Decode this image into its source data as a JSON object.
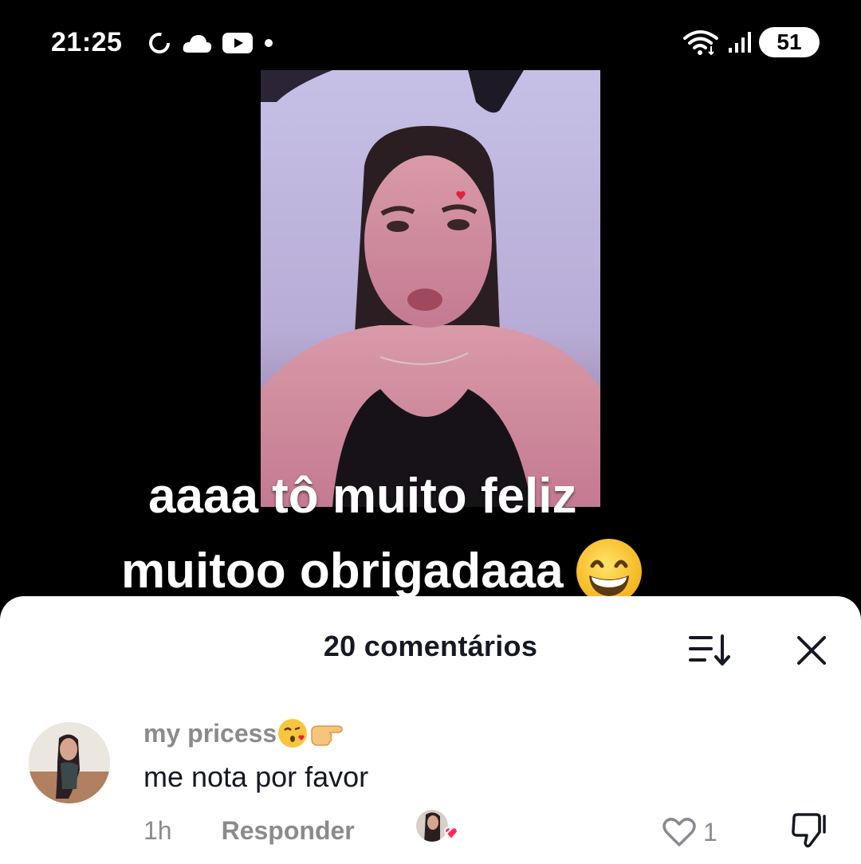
{
  "status_bar": {
    "time": "21:25",
    "battery": "51",
    "left_icons": [
      "sync-icon",
      "cloud-icon",
      "youtube-icon",
      "dot-icon"
    ],
    "right_icons": [
      "wifi-icon",
      "signal-icon",
      "battery-icon"
    ]
  },
  "video": {
    "caption_line1": "aaaa tô muito feliz",
    "caption_line2": "muitoo obrigadaaa",
    "caption_emoji": "grinning-face-icon"
  },
  "comments_sheet": {
    "title": "20 comentários",
    "sort_icon": "sort-icon",
    "close_icon": "close-icon",
    "comments": [
      {
        "username": "my pricess",
        "username_emojis": [
          "kissing-face-icon",
          "pointing-hand-icon"
        ],
        "text": "me nota por favor",
        "time": "1h",
        "reply_label": "Responder",
        "like_count": "1",
        "creator_liked": true
      }
    ]
  },
  "colors": {
    "background": "#000000",
    "sheet": "#ffffff",
    "text_primary": "#161823",
    "text_secondary": "#8a8b91",
    "heart_red": "#fe2c55"
  }
}
